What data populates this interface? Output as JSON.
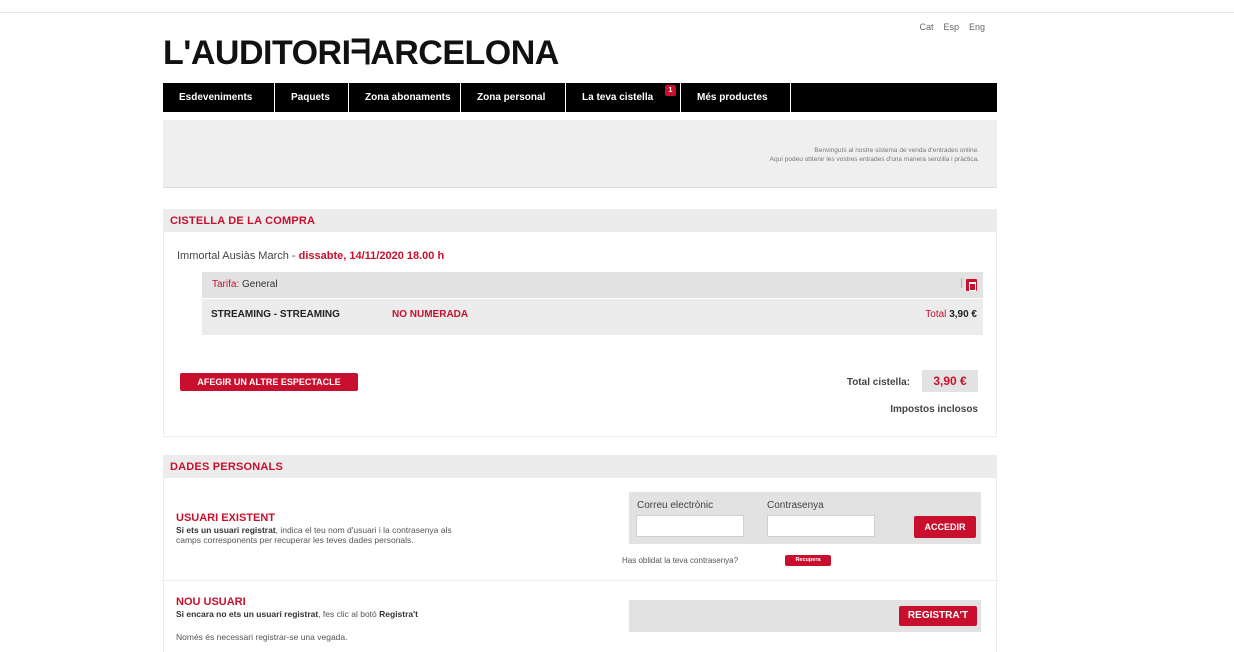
{
  "languages": [
    "Cat",
    "Esp",
    "Eng"
  ],
  "logo": {
    "text": "L'AUDITORIᖷARCELONA"
  },
  "nav": {
    "items": [
      "Esdeveniments",
      "Paquets",
      "Zona abonaments",
      "Zona personal",
      "La teva cistella",
      "Més productes"
    ],
    "cart_badge": "1"
  },
  "welcome": {
    "line1": "Benvinguts al nostre sistema de venda d'entrades online.",
    "line2": "Aquí podeu obtenir les vostres entrades d'una manera senzilla i pràctica."
  },
  "cart": {
    "title": "CISTELLA DE LA COMPRA",
    "event_name": "Immortal Ausiàs March - ",
    "event_date": "dissabte, 14/11/2020 18.00 h",
    "tariff_label": "Tarifa: ",
    "tariff_value": "General",
    "stream_name": "STREAMING - STREAMING",
    "stream_type": "NO NUMERADA",
    "stream_total_label": "Total ",
    "stream_total_value": "3,90 €",
    "add_show_label": "AFEGIR UN ALTRE ESPECTACLE",
    "total_label": "Total cistella:",
    "total_value": "3,90 €",
    "taxes_label": "Impostos inclosos"
  },
  "personal": {
    "title": "DADES PERSONALS",
    "existing_title": "USUARI EXISTENT",
    "existing_text_bold": "Si ets un usuari registrat",
    "existing_text_rest": ", indica el teu nom d'usuari i la contrasenya als",
    "existing_text_line2": "camps corresponents per recuperar les teves dades personals.",
    "email_label": "Correu electrònic",
    "password_label": "Contrasenya",
    "login_label": "ACCEDIR",
    "forgot_text": "Has oblidat la teva contrasenya?",
    "recover_label": "Recupera",
    "new_title": "NOU USUARI",
    "new_text_bold": "Si encara no ets un usuari registrat",
    "new_text_rest": ", fes clic al botó ",
    "new_text_bold2": "Registra't",
    "new_text_line2": "Només és necessari registrar-se una vegada.",
    "register_label": "REGISTRA'T"
  }
}
